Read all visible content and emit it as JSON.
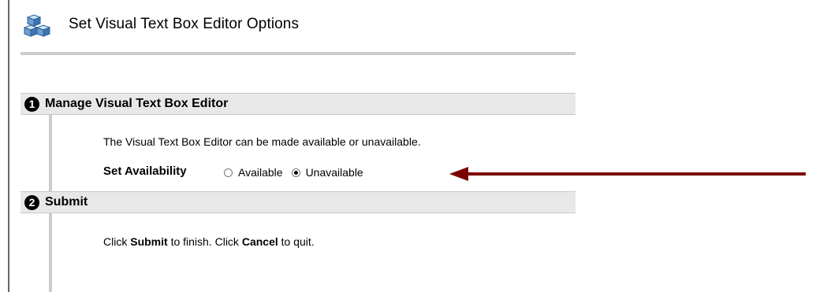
{
  "page": {
    "title": "Set Visual Text Box Editor Options"
  },
  "steps": [
    {
      "number": "1",
      "title": "Manage Visual Text Box Editor"
    },
    {
      "number": "2",
      "title": "Submit"
    }
  ],
  "manage": {
    "description": "The Visual Text Box Editor can be made available or unavailable.",
    "availability_label": "Set Availability",
    "options": [
      {
        "label": "Available",
        "selected": false
      },
      {
        "label": "Unavailable",
        "selected": true
      }
    ]
  },
  "submit": {
    "part1": "Click ",
    "submit_word": "Submit",
    "part2": " to finish. Click ",
    "cancel_word": "Cancel",
    "part3": " to quit."
  },
  "annotation": {
    "arrow_color": "#7a0000"
  }
}
